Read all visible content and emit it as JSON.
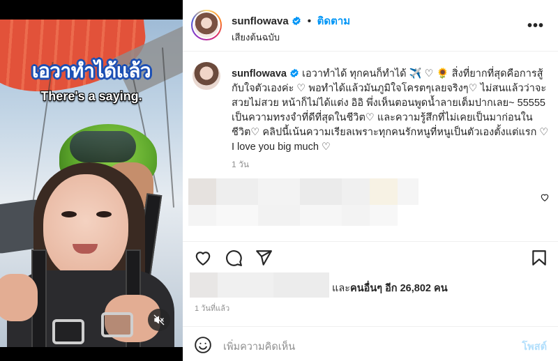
{
  "video": {
    "caption_th": "เอวาทำได้แล้ว",
    "caption_en": "There's a saying.",
    "mute_icon": "speaker-muted-icon"
  },
  "header": {
    "username": "sunflowava",
    "verified_icon": "verified-badge-icon",
    "separator": "•",
    "follow_label": "ติดตาม",
    "audio_label": "เสียงต้นฉบับ",
    "more_label": "•••"
  },
  "caption": {
    "username": "sunflowava",
    "text": "เอวาทำได้ ทุกคนก็ทำได้ ✈️ ♡ 🌻 สิ่งที่ยากที่สุดคือการสู้กับใจตัวเองค่ะ ♡ พอทำได้แล้วมันภูมิใจโครตๆเลยจริงๆ♡ ไม่สนแล้วว่าจะสวยไม่สวย หน้าก็ไม่ได้แต่ง อิอิ พึ่งเห็นตอนพูดน้ำลายเต็มปากเลย~ 55555 เป็นความทรงจำที่ดีที่สุดในชีวิต♡ และความรู้สึกที่ไม่เคยเป็นมาก่อนในชีวิต♡ คลิปนี้เน้นความเรียลเพราะทุกคนรักหนูที่หนูเป็นตัวเองตั้งแต่แรก ♡ I love you big much ♡",
    "time": "1 วัน"
  },
  "actions": {
    "like_icon": "heart-icon",
    "comment_icon": "comment-icon",
    "share_icon": "send-icon",
    "save_icon": "bookmark-icon"
  },
  "likes": {
    "prefix": "และ",
    "others_label": "คนอื่นๆ อีก",
    "count": "26,802",
    "suffix": "คน"
  },
  "post_time": "1 วันที่แล้ว",
  "comment": {
    "emoji_icon": "emoji-icon",
    "placeholder": "เพิ่มความคิดเห็น",
    "post_label": "โพสต์"
  }
}
